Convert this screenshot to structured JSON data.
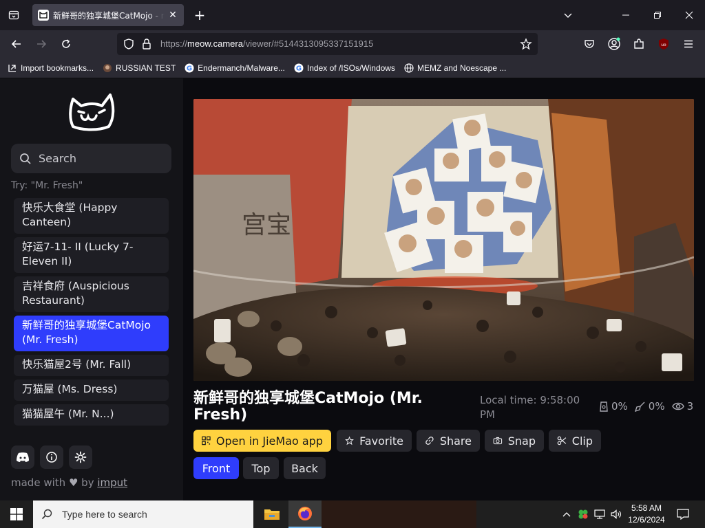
{
  "browser": {
    "tab_title": "新鲜哥的独享城堡CatMojo - meow.camera",
    "url_prefix": "https://",
    "url_domain": "meow.camera",
    "url_path": "/viewer/#5144313095337151915",
    "bookmarks": [
      {
        "label": "Import bookmarks...",
        "icon": "import-icon"
      },
      {
        "label": "RUSSIAN TEST",
        "icon": "site-icon"
      },
      {
        "label": "Endermanch/Malware...",
        "icon": "google-icon"
      },
      {
        "label": "Index of /ISOs/Windows",
        "icon": "google-icon"
      },
      {
        "label": "MEMZ and Noescape ...",
        "icon": "globe-icon"
      }
    ]
  },
  "sidebar": {
    "search_placeholder": "Search",
    "try_hint": "Try: \"Mr. Fresh\"",
    "cameras": [
      {
        "label": "快乐大食堂 (Happy Canteen)",
        "active": false
      },
      {
        "label": "好运7-11- II (Lucky 7-Eleven II)",
        "active": false
      },
      {
        "label": "吉祥食府 (Auspicious Restaurant)",
        "active": false
      },
      {
        "label": "新鲜哥的独享城堡CatMojo (Mr. Fresh)",
        "active": true
      },
      {
        "label": "快乐猫屋2号 (Mr. Fall)",
        "active": false
      },
      {
        "label": "万猫屋 (Ms. Dress)",
        "active": false
      },
      {
        "label": "猫猫屋午 (Mr. N...)",
        "active": false
      }
    ],
    "made_with_prefix": "made with",
    "made_with_by": "by",
    "made_with_link": "imput"
  },
  "viewer": {
    "title": "新鲜哥的独享城堡CatMojo (Mr. Fresh)",
    "local_time": "Local time: 9:58:00 PM",
    "food_level": "0%",
    "clean_level": "0%",
    "viewers": "3",
    "actions": {
      "open_app": "Open in JieMao app",
      "favorite": "Favorite",
      "share": "Share",
      "snap": "Snap",
      "clip": "Clip"
    },
    "views": [
      "Front",
      "Top",
      "Back"
    ],
    "active_view": "Front",
    "accent": "#2f3dfc",
    "yellow": "#ffd23f"
  },
  "taskbar": {
    "search_placeholder": "Type here to search",
    "time": "5:58 AM",
    "date": "12/6/2024"
  }
}
